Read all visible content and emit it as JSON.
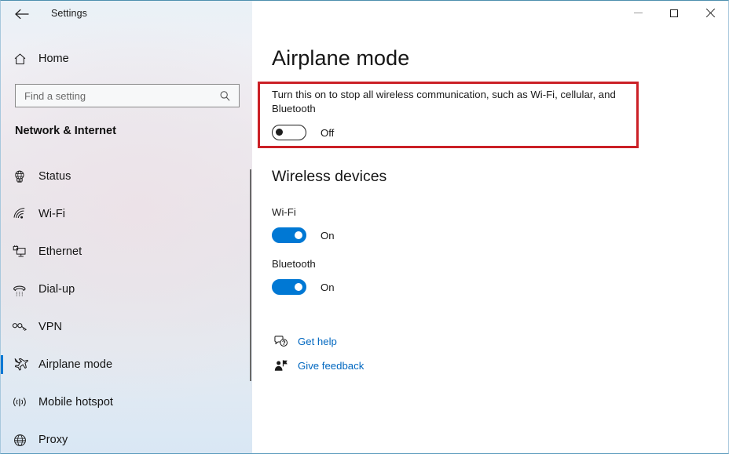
{
  "window": {
    "title": "Settings",
    "back_icon": "back-arrow-icon",
    "minimize_label": "—",
    "maximize_label": "□",
    "close_label": "✕"
  },
  "sidebar": {
    "home": {
      "label": "Home",
      "icon": "home-icon"
    },
    "search": {
      "value": "",
      "placeholder": "Find a setting",
      "icon": "search-icon"
    },
    "category": "Network & Internet",
    "items": [
      {
        "label": "Status",
        "icon": "status-globe-icon",
        "selected": false
      },
      {
        "label": "Wi-Fi",
        "icon": "wifi-icon",
        "selected": false
      },
      {
        "label": "Ethernet",
        "icon": "ethernet-icon",
        "selected": false
      },
      {
        "label": "Dial-up",
        "icon": "dialup-phone-icon",
        "selected": false
      },
      {
        "label": "VPN",
        "icon": "vpn-key-icon",
        "selected": false
      },
      {
        "label": "Airplane mode",
        "icon": "airplane-icon",
        "selected": true
      },
      {
        "label": "Mobile hotspot",
        "icon": "hotspot-icon",
        "selected": false
      },
      {
        "label": "Proxy",
        "icon": "proxy-globe-icon",
        "selected": false
      }
    ]
  },
  "main": {
    "page_title": "Airplane mode",
    "airplane": {
      "description": "Turn this on to stop all wireless communication, such as Wi-Fi, cellular, and Bluetooth",
      "state": "Off",
      "is_on": false,
      "highlight_color": "#cb2026"
    },
    "wireless_devices": {
      "heading": "Wireless devices",
      "devices": [
        {
          "label": "Wi-Fi",
          "state": "On",
          "is_on": true
        },
        {
          "label": "Bluetooth",
          "state": "On",
          "is_on": true
        }
      ]
    },
    "footer_links": [
      {
        "label": "Get help",
        "icon": "help-bubble-icon"
      },
      {
        "label": "Give feedback",
        "icon": "feedback-person-icon"
      }
    ]
  },
  "colors": {
    "accent": "#0078d4",
    "link": "#0067c0",
    "highlight": "#cb2026"
  }
}
